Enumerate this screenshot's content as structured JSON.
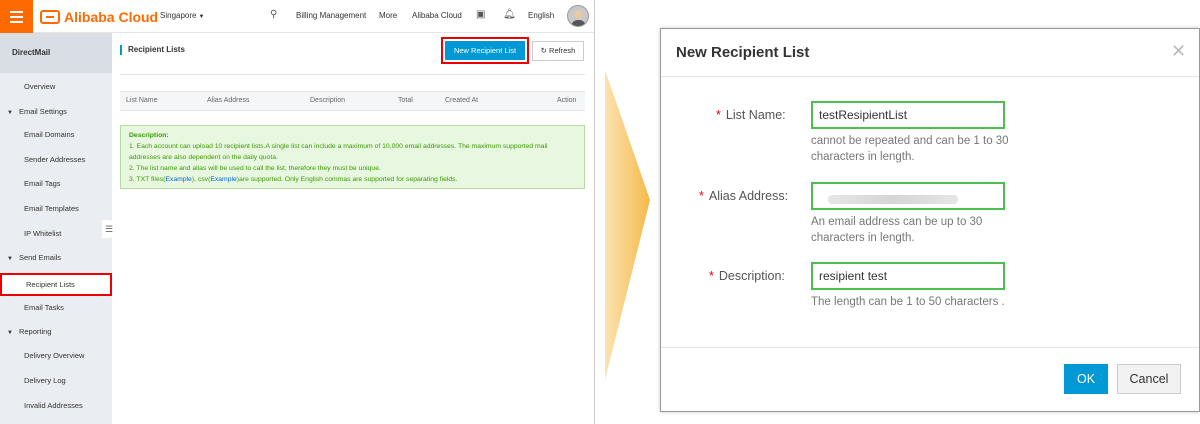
{
  "console": {
    "logo_text": "Alibaba Cloud",
    "region": "Singapore",
    "nav": [
      "Billing Management",
      "More",
      "Alibaba Cloud",
      "English"
    ],
    "sidebar": {
      "title": "DirectMail",
      "items": [
        {
          "label": "Overview",
          "type": "sub"
        },
        {
          "label": "Email Settings",
          "type": "group"
        },
        {
          "label": "Email Domains",
          "type": "sub"
        },
        {
          "label": "Sender Addresses",
          "type": "sub"
        },
        {
          "label": "Email Tags",
          "type": "sub"
        },
        {
          "label": "Email Templates",
          "type": "sub"
        },
        {
          "label": "IP Whitelist",
          "type": "sub"
        },
        {
          "label": "Send Emails",
          "type": "group"
        },
        {
          "label": "Recipient Lists",
          "type": "sub",
          "active": true
        },
        {
          "label": "Email Tasks",
          "type": "sub"
        },
        {
          "label": "Reporting",
          "type": "group"
        },
        {
          "label": "Delivery Overview",
          "type": "sub"
        },
        {
          "label": "Delivery Log",
          "type": "sub"
        },
        {
          "label": "Invalid Addresses",
          "type": "sub"
        }
      ]
    },
    "page_title": "Recipient Lists",
    "new_button": "New Recipient List",
    "refresh_button": "Refresh",
    "table_headers": [
      "List Name",
      "Alias Address",
      "Description",
      "Total",
      "Created At",
      "Action"
    ],
    "description": {
      "title": "Description:",
      "line1": "1. Each account can upload 10 recipient lists.A single list can include a maximum of 10,000 email addresses. The maximum supported mail addresses are also dependent on the daily quota.",
      "line2": "2. The list name and alias will be used to call the list, therefore they must be unique.",
      "line3_a": "3. TXT files(",
      "line3_link1": "Example",
      "line3_b": "),  csv(",
      "line3_link2": "Example",
      "line3_c": ")are supported. Only English commas are supported for separating fields."
    }
  },
  "dialog": {
    "title": "New Recipient List",
    "fields": {
      "list_name": {
        "label": "List Name:",
        "value": "testResipientList",
        "help": "cannot be repeated and can be 1 to 30 characters in length."
      },
      "alias_address": {
        "label": "Alias Address:",
        "value": "",
        "help": "An email address can be up to 30 characters in length."
      },
      "description": {
        "label": "Description:",
        "value": "resipient test",
        "help": "The length can be 1 to 50 characters ."
      }
    },
    "ok_button": "OK",
    "cancel_button": "Cancel"
  },
  "colors": {
    "brand_orange": "#ff6a00",
    "primary_blue": "#0099d6",
    "highlight_red": "#ee0000",
    "valid_green": "#4cc04c",
    "arrow_yellow": "#f7c66a"
  }
}
